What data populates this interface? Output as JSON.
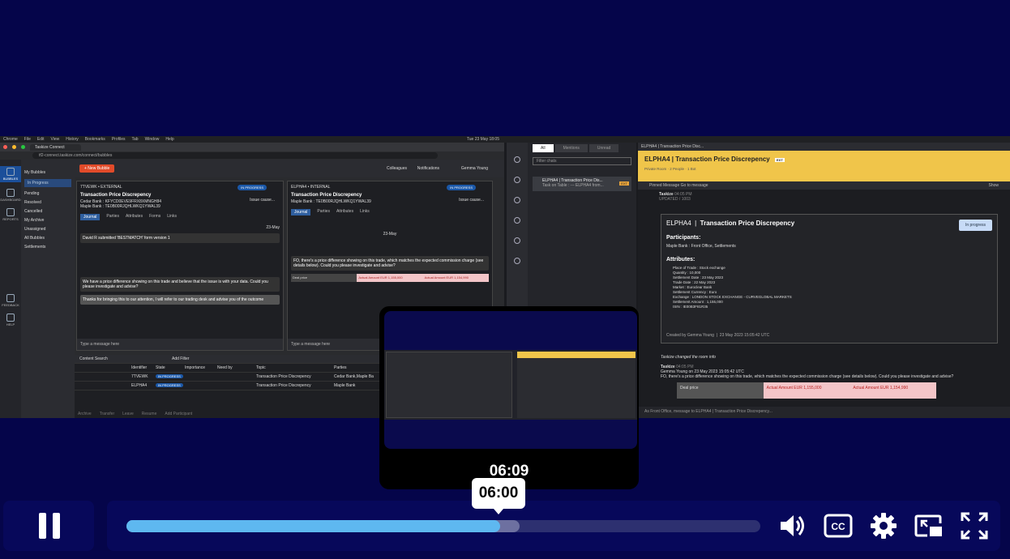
{
  "player": {
    "preview_time": "06:09",
    "hover_time": "06:00",
    "progress_played": 0.59,
    "progress_buffered": 0.62,
    "controls": {
      "pause_icon": "pause-icon",
      "volume_icon": "volume-icon",
      "captions_icon": "closed-captions-icon",
      "settings_icon": "gear-icon",
      "miniplayer_icon": "miniplayer-icon",
      "fullscreen_icon": "fullscreen-icon"
    },
    "colors": {
      "played": "#5eb8f0",
      "buffered": "#6d70a0",
      "track": "#2d3070",
      "background": "#05054a"
    }
  },
  "recording": {
    "menubar": {
      "items": [
        "Chrome",
        "File",
        "Edit",
        "View",
        "History",
        "Bookmarks",
        "Profiles",
        "Tab",
        "Window",
        "Help"
      ],
      "clock": "Tue 23 May 18:05"
    },
    "browser": {
      "tab_title": "Taskize Connect",
      "url": "tf2-connect.taskize.com/connect/bubbles",
      "nav": [
        "BUBBLES",
        "DASHBOARD",
        "REPORTS",
        "FEEDBACK",
        "HELP"
      ],
      "sidebar": {
        "my_bubbles": "My Bubbles",
        "items": [
          "In Progress",
          "Pending",
          "Resolved",
          "Cancelled"
        ],
        "my_archive": "My Archive",
        "unassigned": "Unassigned",
        "all_bubbles": "All Bubbles",
        "settlements": "Settlements"
      },
      "new_bubble": "+ New Bubble",
      "colleagues": "Colleagues",
      "notifications": "Notifications",
      "user": "Gemma Young",
      "panel_left": {
        "crumb": "7TVEWK • EXTERNAL",
        "title": "Transaction Price Discrepency",
        "lines": [
          "Cedar Bank : KFYCD0EVE9FRX8XMNGH84",
          "Maple Bank : TE0B00RJQHLWKQ1YWAL39"
        ],
        "status": "IN PROGRESS",
        "issue": "Issue cause...",
        "tabs": [
          "Journal",
          "Parties",
          "Attributes",
          "Forms",
          "Links"
        ],
        "date": "23-May",
        "entry": "David R submitted 'BESTMATCH' form version 1",
        "msg1": "We have a price difference showing on this trade and believe that the issue is with your data. Could you please investigate and advise?",
        "msg2": "Thanks for bringing this to our attention, I will refer to our trading desk and advise you of the outcome",
        "input": "Type a message here"
      },
      "panel_right": {
        "crumb": "ELPHA4 • INTERNAL",
        "title": "Transaction Price Discrepency",
        "line": "Maple Bank : TE0B00RJQHLWKQ1YWAL39",
        "status": "IN PROGRESS",
        "issue": "Issue cause...",
        "tabs": [
          "Journal",
          "Parties",
          "Attributes",
          "Links"
        ],
        "date": "23-May",
        "msg": "FO, there's a price difference showing on this trade, which matches the expected commission charge (see details below). Could you please investigate and advise?",
        "deal_price": "Deal price",
        "actual1": "Actual Amount EUR 1,155,000",
        "actual2": "Actual Amount EUR 1,154,990",
        "input": "Type a message here"
      },
      "grid": {
        "search": "Content Search",
        "add_filter": "Add Filter",
        "columns": [
          "Identifier",
          "State",
          "Importance",
          "Need by",
          "Topic",
          "Parties"
        ],
        "rows": [
          {
            "id": "7TVEWK",
            "state": "IN PROGRESS",
            "topic": "Transaction Price Discrepency",
            "parties": "Cedar Bank,Maple Ba"
          },
          {
            "id": "ELPHA4",
            "state": "IN PROGRESS",
            "topic": "Transaction Price Discrepency",
            "parties": "Maple Bank"
          }
        ],
        "footer": [
          "Archive",
          "Transfer",
          "Leave",
          "Resume",
          "Add Participant"
        ]
      }
    },
    "sidepanel": {
      "filters": [
        "All",
        "Mentions",
        "Unread"
      ],
      "filter_placeholder": "Filter chats",
      "chat_title": "ELPHA4 | Transaction Price Dis...",
      "chat_sub": "Task on Table : --- ELPHA4 from...",
      "chat_badge": "EXT"
    },
    "room": {
      "tab": "ELPHA4 | Transaction Price Disc...",
      "title": "ELPHA4 | Transaction Price Discrepency",
      "badge": "EXT",
      "sub": "Private Room · 2 People · 1 Bot",
      "pinned": "Pinned Message  Go to message",
      "show": "Show",
      "sender": "Taskize",
      "sender_time": "04:05 PM",
      "updated": "UPDATED / 1003",
      "card": {
        "org": "ELPHA4",
        "title": "Transaction Price Discrepency",
        "status": "In progress",
        "participants_h": "Participants:",
        "participants": "Maple Bank : Front Office, Settlements",
        "attributes_h": "Attributes:",
        "attributes": [
          "Place of Trade : Stock exchange",
          "Quantity : 10,000",
          "Settlement Date : 23 May 2023",
          "Trade Date : 22 May 2023",
          "Market : Euroclear Bank",
          "Settlement Currency : Euro",
          "Exchange : LONDON STOCK EXCHANGE - CURVEGLOBAL MARKETS",
          "Settlement Amount : 1,155,000",
          "ISIN : IE00B3F81R35"
        ],
        "created_by": "Created by Gemma Young",
        "created_at": "23 May 2023 15:05:42 UTC"
      },
      "changed": "Taskize changed the room info",
      "sender2": "Taskize",
      "sender2_time": "04:05 PM",
      "msg_head": "Gemma Young on 23 May 2023 15:05:42 UTC",
      "msg": "FO, there's a price difference showing on this trade, which matches the expected commission charge (see details below). Could you please investigate and advise?",
      "deal_price": "Deal price",
      "actual1": "Actual Amount EUR 1,155,000",
      "actual2": "Actual Amount EUR 1,154,990",
      "composer": "As Front Office, message to ELPHA4 | Transaction Price Discrepency..."
    }
  }
}
